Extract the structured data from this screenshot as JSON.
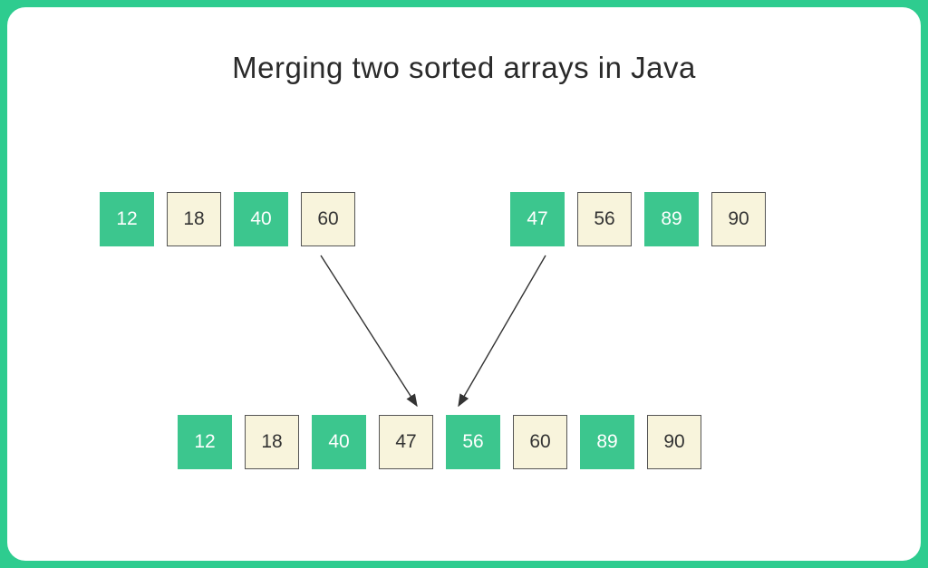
{
  "title": "Merging two sorted arrays in Java",
  "arrayA": [
    {
      "value": "12",
      "style": "green"
    },
    {
      "value": "18",
      "style": "cream"
    },
    {
      "value": "40",
      "style": "green"
    },
    {
      "value": "60",
      "style": "cream"
    }
  ],
  "arrayB": [
    {
      "value": "47",
      "style": "green"
    },
    {
      "value": "56",
      "style": "cream"
    },
    {
      "value": "89",
      "style": "green"
    },
    {
      "value": "90",
      "style": "cream"
    }
  ],
  "merged": [
    {
      "value": "12",
      "style": "green"
    },
    {
      "value": "18",
      "style": "cream"
    },
    {
      "value": "40",
      "style": "green"
    },
    {
      "value": "47",
      "style": "cream"
    },
    {
      "value": "56",
      "style": "green"
    },
    {
      "value": "60",
      "style": "cream"
    },
    {
      "value": "89",
      "style": "green"
    },
    {
      "value": "90",
      "style": "cream"
    }
  ]
}
